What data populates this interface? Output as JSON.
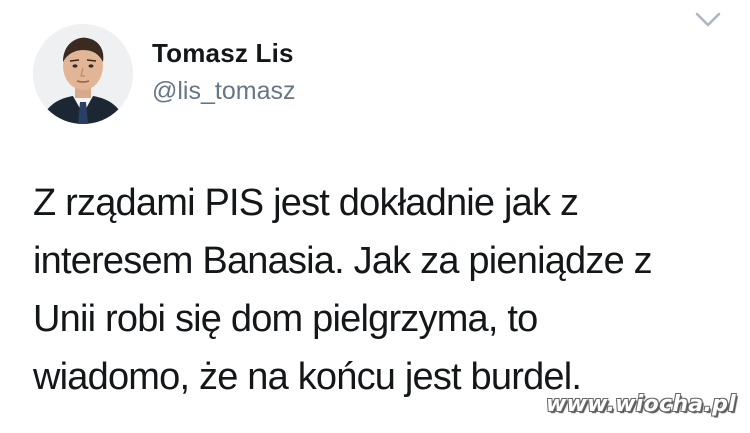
{
  "tweet": {
    "author": {
      "name": "Tomasz Lis",
      "handle": "@lis_tomasz",
      "avatar_icon": "profile-photo"
    },
    "menu_icon": "chevron-down-icon",
    "text_lines": [
      "Z rządami PIS jest dokładnie jak z",
      "interesem Banasia. Jak za pieniądze z",
      "Unii robi się dom pielgrzyma, to",
      "wiadomo, że na końcu jest burdel."
    ]
  },
  "watermark": {
    "text": "www.wiocha.pl"
  },
  "colors": {
    "background": "#ffffff",
    "text": "#14171a",
    "secondary_text": "#657786",
    "chevron": "#aab8c2"
  }
}
